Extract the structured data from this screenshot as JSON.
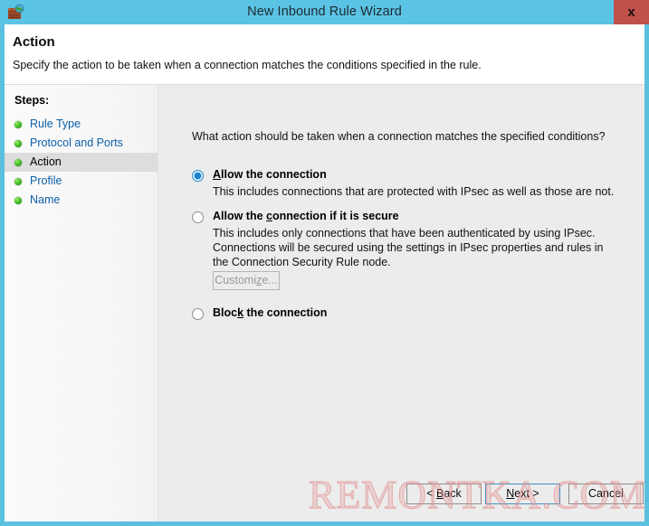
{
  "window": {
    "title": "New Inbound Rule Wizard",
    "icon": "firewall-icon",
    "close_label": "x",
    "accent_color": "#5bc3e4",
    "close_color": "#c0504a"
  },
  "header": {
    "title": "Action",
    "subtitle": "Specify the action to be taken when a connection matches the conditions specified in the rule."
  },
  "sidebar": {
    "title": "Steps:",
    "items": [
      {
        "label": "Rule Type",
        "current": false
      },
      {
        "label": "Protocol and Ports",
        "current": false
      },
      {
        "label": "Action",
        "current": true
      },
      {
        "label": "Profile",
        "current": false
      },
      {
        "label": "Name",
        "current": false
      }
    ]
  },
  "main": {
    "question": "What action should be taken when a connection matches the specified conditions?",
    "options": [
      {
        "id": "allow",
        "label_pre": "",
        "label_acc": "A",
        "label_post": "llow the connection",
        "label": "Allow the connection",
        "description": "This includes connections that are protected with IPsec as well as those are not.",
        "selected": true
      },
      {
        "id": "allow-if-secure",
        "label_pre": "Allow the ",
        "label_acc": "c",
        "label_post": "onnection if it is secure",
        "label": "Allow the connection if it is secure",
        "description": "This includes only connections that have been authenticated by using IPsec.  Connections will be secured using the settings in IPsec properties and rules in the Connection Security Rule node.",
        "selected": false
      },
      {
        "id": "block",
        "label_pre": "Bloc",
        "label_acc": "k",
        "label_post": " the connection",
        "label": "Block the connection",
        "description": "",
        "selected": false
      }
    ],
    "customize_button": {
      "pre": "Customi",
      "acc": "z",
      "post": "e...",
      "label": "Customize...",
      "enabled": false
    }
  },
  "footer": {
    "back": {
      "pre": "< ",
      "acc": "B",
      "post": "ack",
      "label": "< Back"
    },
    "next": {
      "pre": "",
      "acc": "N",
      "post": "ext >",
      "label": "Next >",
      "focused": true
    },
    "cancel": {
      "label": "Cancel"
    }
  },
  "watermark": {
    "text": "REMONTKA.COM"
  }
}
